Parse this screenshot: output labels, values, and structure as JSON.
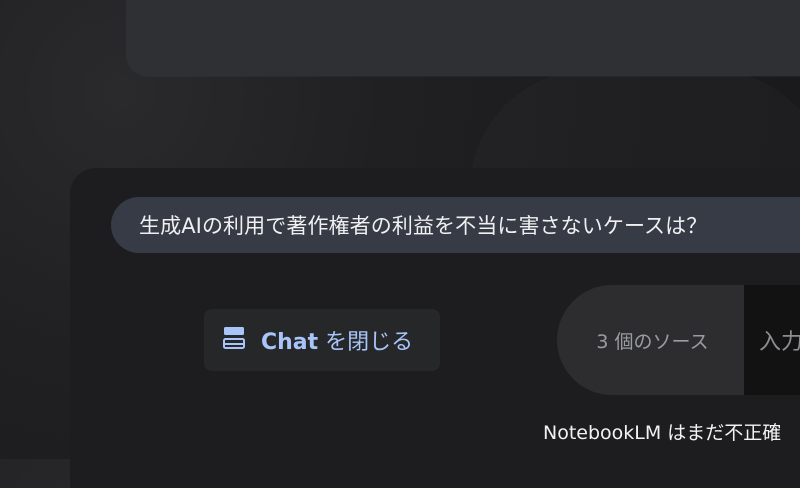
{
  "suggestion": {
    "text": "生成AIの利用で著作権者の利益を不当に害さないケースは？"
  },
  "close_chat": {
    "label_bold": "Chat",
    "label_rest": " を閉じる",
    "icon": "panel-collapse-icon"
  },
  "input": {
    "sources_label": "3 個のソース",
    "placeholder": "入力"
  },
  "footer": {
    "disclaimer": "NotebookLM はまだ不正確"
  },
  "colors": {
    "accent": "#a8c4f8",
    "chip_bg": "#363b46",
    "background": "#1a1a1c"
  }
}
